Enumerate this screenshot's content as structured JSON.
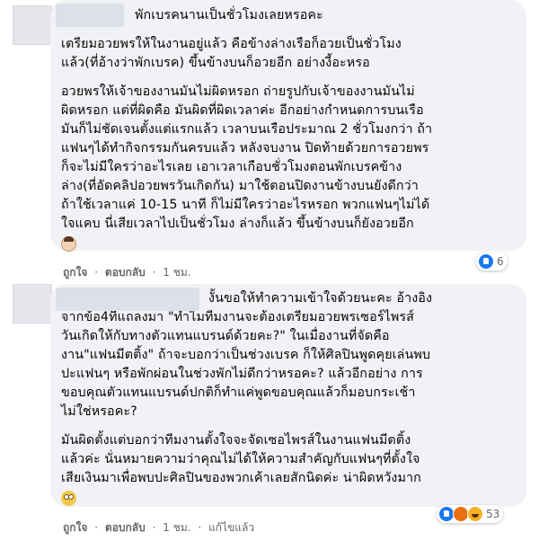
{
  "comment1": {
    "heading": "พักเบรคนานเป็นชั่วโมงเลยหรอคะ",
    "para1": [
      "เตรียมอวยพรให้ในงานอยู่แล้ว คือข้างล่างเรือก็อวยเป็นชั่วโมง",
      "แล้ว(ที่อ้างว่าพักเบรค) ขึ้นข้างบนก็อวยอีก อย่างงี้อะหรอ"
    ],
    "para2": [
      "อวยพรให้เจ้าของงานมันไม่ผิดหรอก ถ่ายรูปกับเจ้าของงานมันไม่",
      "ผิดหรอก แต่ที่ผิดคือ มันผิดที่ผิดเวลาค่ะ อีกอย่างกำหนดการบนเรือ",
      "มันก็ไม่ชัดเจนตั้งแต่แรกแล้ว เวลาบนเรือประมาณ 2 ชั่วโมงกว่า ถ้า",
      "แฟนๆได้ทำกิจกรรมกันครบแล้ว หลังจบงาน ปิดท้ายด้วยการอวยพร",
      "ก็จะไม่มีใครว่าอะไรเลย เอาเวลาเกือบชั่วโมงตอนพักเบรคข้าง",
      "ล่าง(ที่อัดคลิปอวยพรวันเกิดกัน) มาใช้ตอนปิดงานข้างบนยังดีกว่า",
      "ถ้าใช้เวลาแค่ 10-15 นาที ก็ไม่มีใครว่าอะไรหรอก พวกแฟนๆไม่ได้",
      "ใจแคบ นี่เสียเวลาไปเป็นชั่วโมง ล่างก็แล้ว ขึ้นข้างบนก็ยังอวยอีก"
    ],
    "emoji": "person-shrug-emoji",
    "actions": {
      "like": "ถูกใจ",
      "reply": "ตอบกลับ",
      "time": "1 ชม."
    },
    "reactions": {
      "count": "6"
    }
  },
  "comment2": {
    "para1": [
      "งั้นขอให้ทำความเข้าใจด้วยนะคะ อ้างอิง",
      "จากข้อ4ที่แถลงมา \"ทำไมทีมงานจะต้องเตรียมอวยพรเซอร์ไพรส์",
      "วันเกิดให้กับทางตัวแทนแบรนด์ด้วยคะ?\" ในเมื่องานที่จัดคือ",
      "งาน\"แฟนมีตติ้ง\" ถ้าจะบอกว่าเป็นช่วงเบรค ก็ให้ศิลปินพูดคุยเล่นพบ",
      "ปะแฟนๆ หรือพักผ่อนในช่วงพักไม่ดีกว่าหรอคะ? แล้วอีกอย่าง การ",
      "ขอบคุณตัวแทนแบรนด์ปกติก็ทำแค่พูดขอบคุณแล้วก็มอบกระเช้า",
      "ไม่ใช่หรอคะ?"
    ],
    "para2": [
      "มันผิดตั้งแต่บอกว่าทีมงานตั้งใจจะจัดเซอไพรส์ในงานแฟนมีตติ้ง",
      "แล้วค่ะ นั่นหมายความว่าคุณไม่ได้ให้ความสำคัญกับแฟนๆที่ตั้งใจ",
      "เสียเงินมาเพื่อพบปะศิลปินของพวกเค้าเลยสักนิดค่ะ น่าผิดหวังมาก"
    ],
    "emoji": "face-with-rolling-eyes-emoji",
    "actions": {
      "like": "ถูกใจ",
      "reply": "ตอบกลับ",
      "time": "1 ชม.",
      "edited": "แก้ไขแล้ว"
    },
    "reactions": {
      "count": "53"
    }
  },
  "colors": {
    "bubble": "#f0f2f5",
    "meta": "#65676b",
    "like_blue": "#1877f2"
  }
}
